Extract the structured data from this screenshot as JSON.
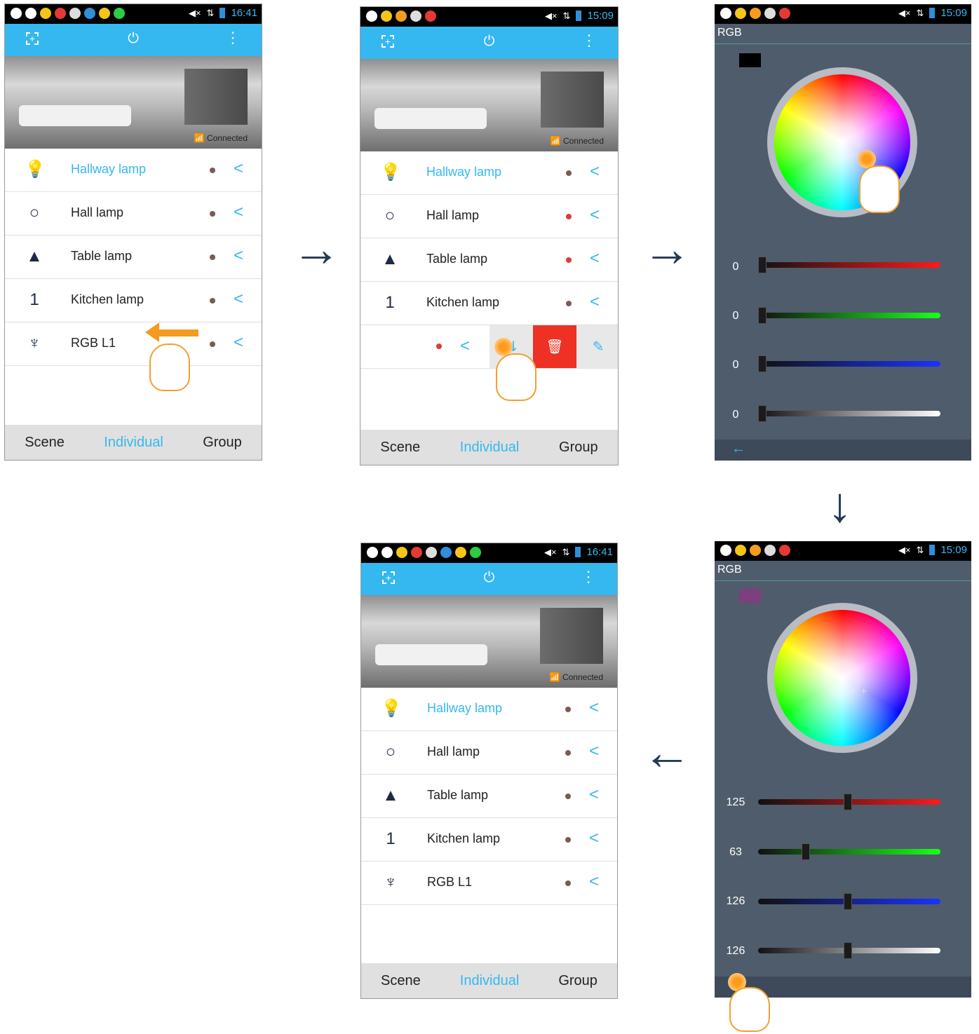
{
  "status_a": {
    "time": "16:41"
  },
  "status_b": {
    "time": "15:09"
  },
  "banner": {
    "connected": "Connected"
  },
  "lamps": [
    {
      "name": "Hallway lamp",
      "icon": "lightbulb-icon"
    },
    {
      "name": "Hall lamp",
      "icon": "bulb-outline-icon"
    },
    {
      "name": "Table lamp",
      "icon": "table-lamp-icon"
    },
    {
      "name": "Kitchen lamp",
      "icon": "numbered-bulb-icon"
    },
    {
      "name": "RGB L1",
      "icon": "chandelier-icon"
    }
  ],
  "kitchen_badge": "1",
  "nav": {
    "scene": "Scene",
    "individual": "Individual",
    "group": "Group"
  },
  "rgb": {
    "title": "RGB",
    "initial": {
      "r": "0",
      "g": "0",
      "b": "0",
      "w": "0",
      "r_level": 0,
      "g_level": 0,
      "b_level": 0,
      "w_level": 0,
      "swatch": "#000000"
    },
    "adjusted": {
      "r": "125",
      "g": "63",
      "b": "126",
      "w": "126",
      "r_level": 0.49,
      "g_level": 0.25,
      "b_level": 0.49,
      "w_level": 0.49,
      "swatch": "#7d3f7e"
    }
  },
  "colors": {
    "accent": "#35b8f0",
    "delete": "#ee3124",
    "panel": "#4f5c6b"
  }
}
